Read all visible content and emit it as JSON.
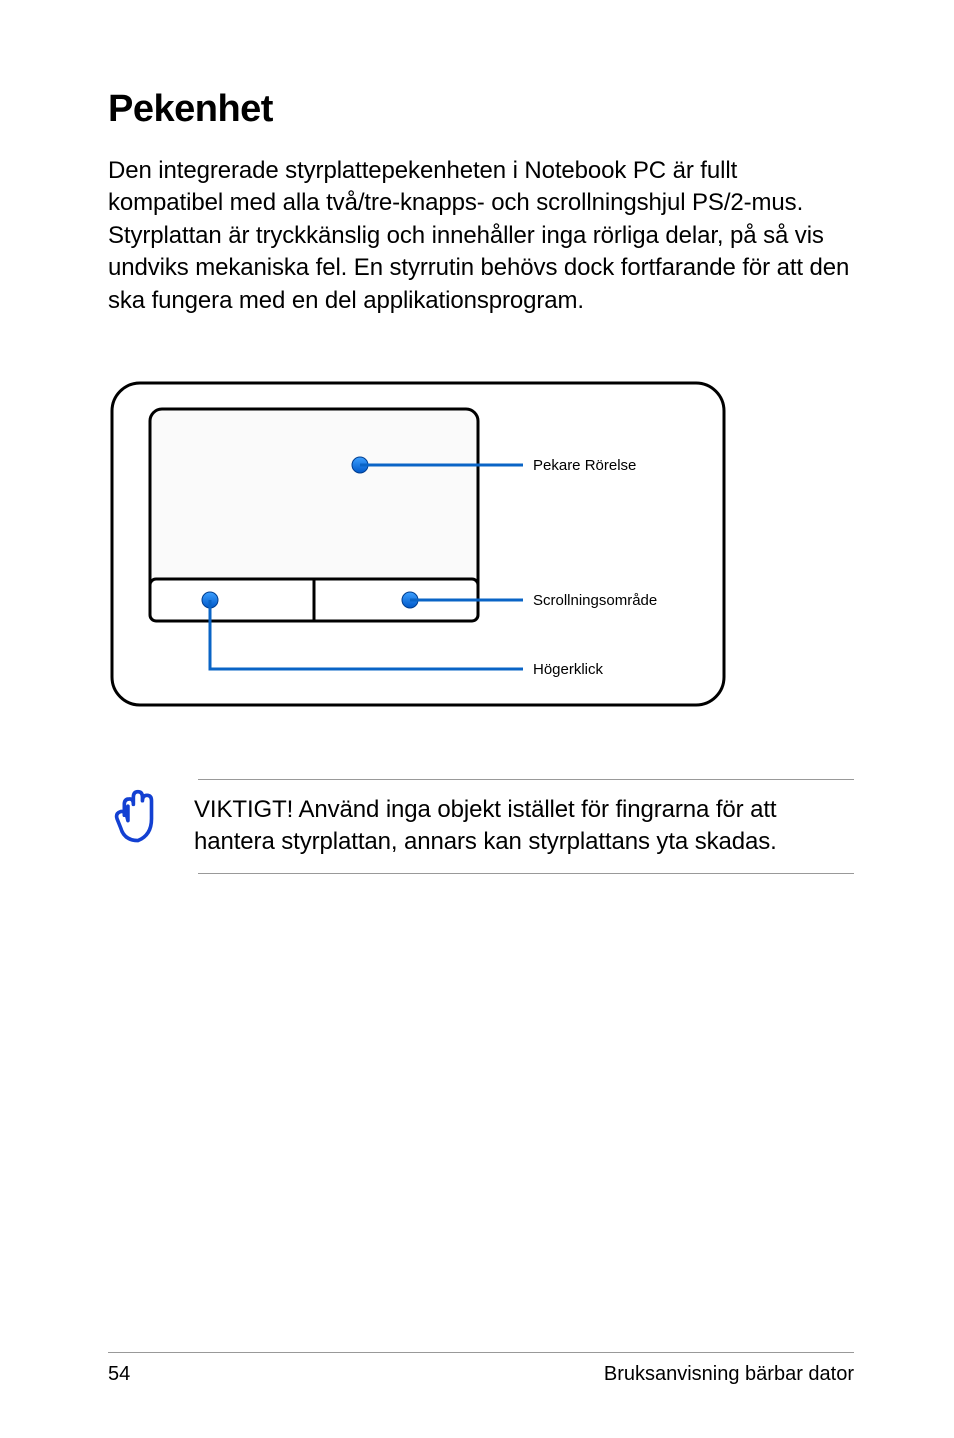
{
  "heading": "Pekenhet",
  "paragraph": "Den integrerade styrplattepekenheten i Notebook PC är fullt kompatibel med alla två/tre-knapps- och scrollningshjul PS/2-mus. Styrplattan är tryckkänslig och innehåller inga rörliga delar, på så vis undviks mekaniska fel.  En styrrutin behövs dock fortfarande för att den ska fungera med en del applikationsprogram.",
  "diagram": {
    "label_movement": "Pekare Rörelse",
    "label_scroll": "Scrollningsområde",
    "label_rightclick": "Högerklick"
  },
  "note": "VIKTIGT! Använd inga objekt istället för fingrarna för att hantera styrplattan, annars kan styrplattans yta skadas.",
  "footer": {
    "page": "54",
    "title": "Bruksanvisning bärbar dator"
  }
}
